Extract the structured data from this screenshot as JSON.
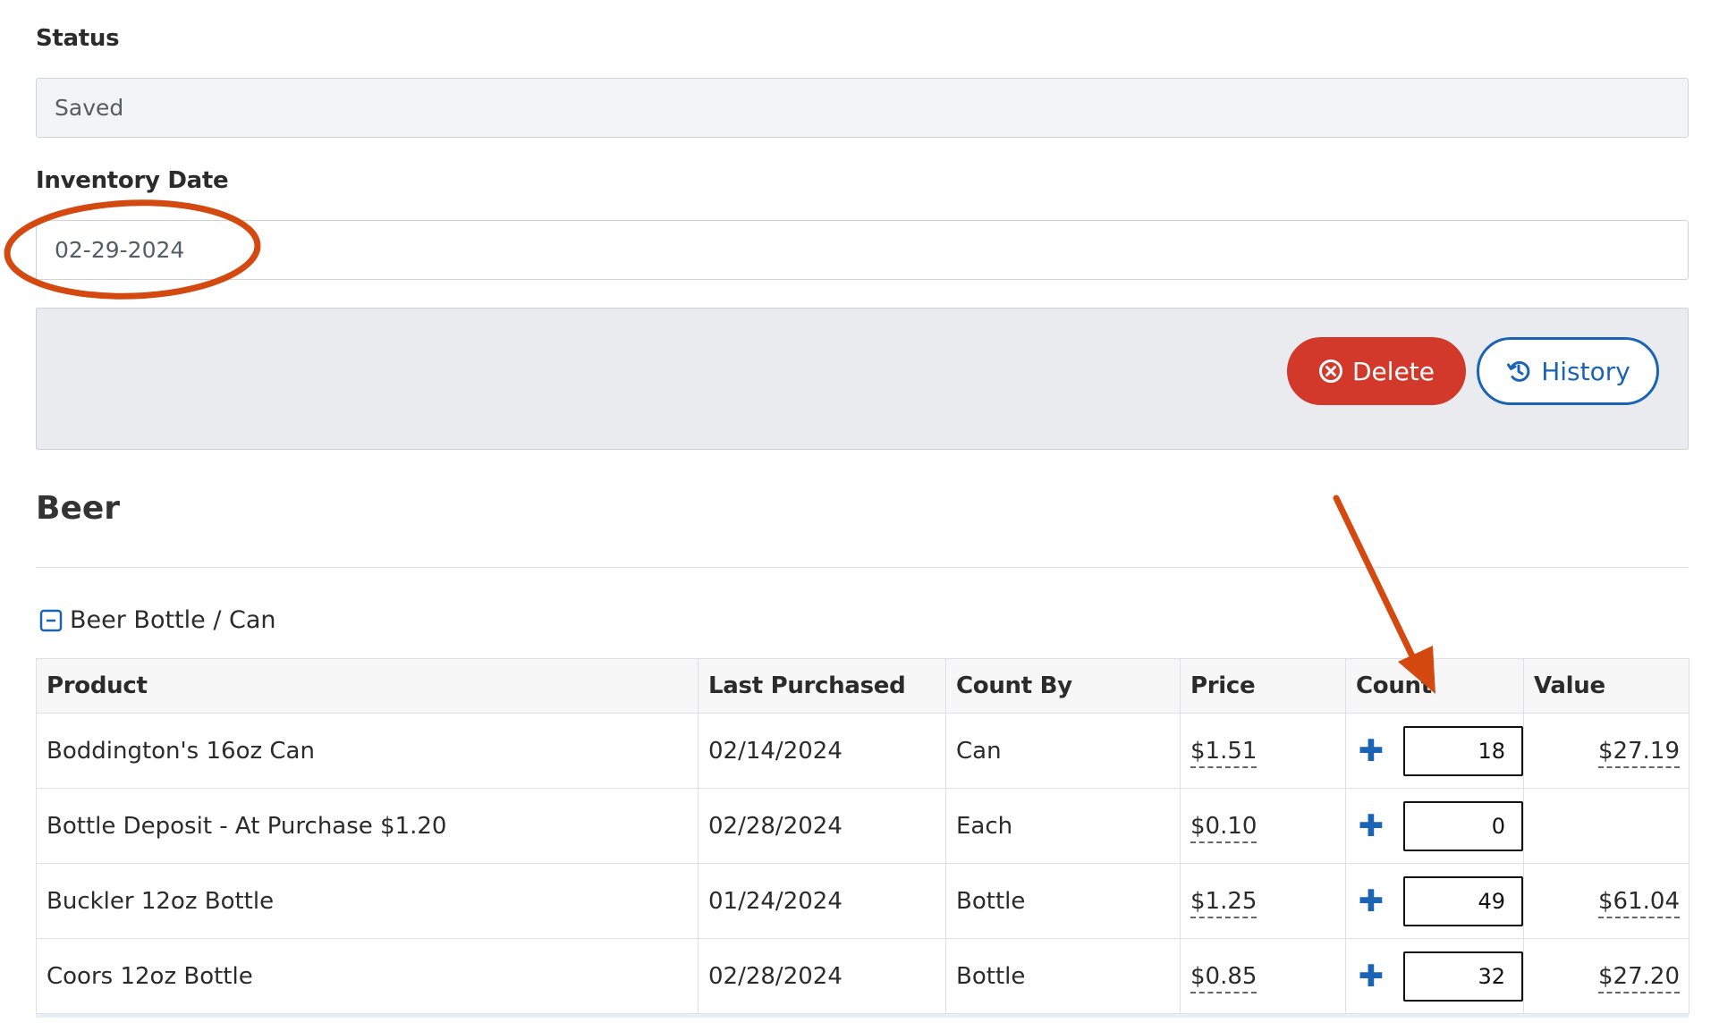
{
  "status": {
    "label": "Status",
    "value": "Saved"
  },
  "inventory_date": {
    "label": "Inventory Date",
    "value": "02-29-2024"
  },
  "toolbar": {
    "delete_label": "Delete",
    "history_label": "History"
  },
  "section": {
    "title": "Beer"
  },
  "group": {
    "label": "Beer Bottle / Can"
  },
  "table": {
    "headers": {
      "product": "Product",
      "last_purchased": "Last Purchased",
      "count_by": "Count By",
      "price": "Price",
      "count": "Count",
      "value": "Value"
    },
    "rows": [
      {
        "product": "Boddington's 16oz Can",
        "last_purchased": "02/14/2024",
        "count_by": "Can",
        "price": "$1.51",
        "count": "18",
        "value": "$27.19"
      },
      {
        "product": "Bottle Deposit - At Purchase $1.20",
        "last_purchased": "02/28/2024",
        "count_by": "Each",
        "price": "$0.10",
        "count": "0",
        "value": ""
      },
      {
        "product": "Buckler 12oz Bottle",
        "last_purchased": "01/24/2024",
        "count_by": "Bottle",
        "price": "$1.25",
        "count": "49",
        "value": "$61.04"
      },
      {
        "product": "Coors 12oz Bottle",
        "last_purchased": "02/28/2024",
        "count_by": "Bottle",
        "price": "$0.85",
        "count": "32",
        "value": "$27.20"
      }
    ]
  },
  "colors": {
    "delete": "#d2392b",
    "accent": "#1a63b5",
    "annotation": "#d4490f"
  },
  "icons": {
    "delete": "times-circle-icon",
    "history": "history-icon",
    "collapse": "minus-square-icon",
    "add": "plus-icon"
  }
}
